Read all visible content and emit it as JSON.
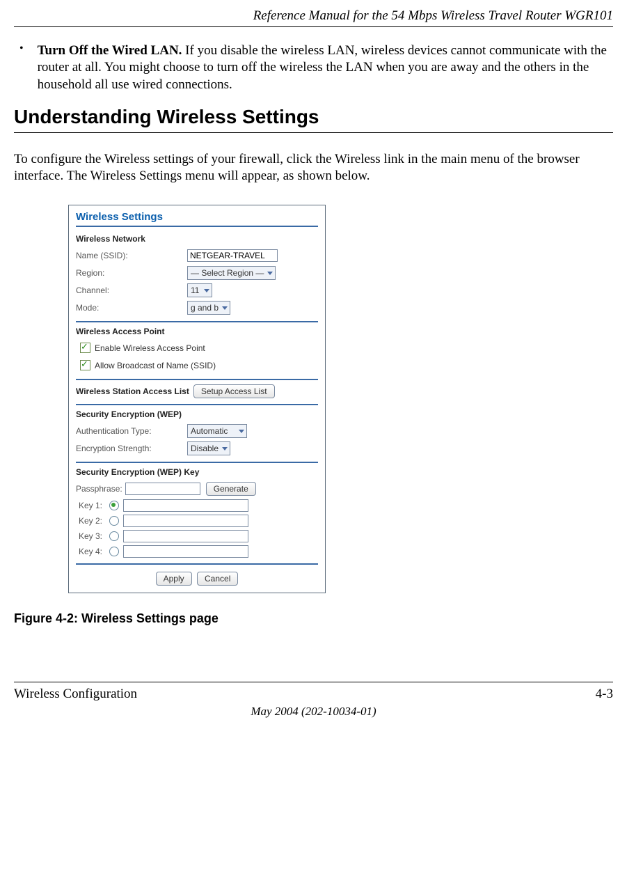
{
  "header": {
    "manual_title": "Reference Manual for the 54 Mbps Wireless Travel Router WGR101"
  },
  "bullet": {
    "title": "Turn Off the Wired LAN.",
    "text": " If you disable the wireless LAN, wireless devices cannot communicate with the router at all. You might choose to turn off the wireless the LAN when you are away and the others in the household all use wired connections."
  },
  "section_heading": "Understanding Wireless Settings",
  "intro_paragraph": "To configure the Wireless settings of your firewall, click the Wireless link in the main menu of the browser interface. The Wireless Settings menu will appear, as shown below.",
  "ui": {
    "title": "Wireless Settings",
    "wireless_network": {
      "heading": "Wireless Network",
      "name_label": "Name (SSID):",
      "name_value": "NETGEAR-TRAVEL",
      "region_label": "Region:",
      "region_value": "— Select Region —",
      "channel_label": "Channel:",
      "channel_value": "11",
      "mode_label": "Mode:",
      "mode_value": "g and b"
    },
    "access_point": {
      "heading": "Wireless Access Point",
      "enable_label": "Enable Wireless Access Point",
      "broadcast_label": "Allow Broadcast of Name (SSID)"
    },
    "station_access": {
      "heading": "Wireless Station Access List",
      "button": "Setup Access List"
    },
    "wep": {
      "heading": "Security Encryption (WEP)",
      "auth_label": "Authentication Type:",
      "auth_value": "Automatic",
      "enc_label": "Encryption Strength:",
      "enc_value": "Disable"
    },
    "wep_key": {
      "heading": "Security Encryption (WEP) Key",
      "passphrase_label": "Passphrase:",
      "generate_button": "Generate",
      "key1": "Key 1:",
      "key2": "Key 2:",
      "key3": "Key 3:",
      "key4": "Key 4:"
    },
    "buttons": {
      "apply": "Apply",
      "cancel": "Cancel"
    }
  },
  "figure_caption": "Figure 4-2:  Wireless Settings page",
  "footer": {
    "section": "Wireless Configuration",
    "page": "4-3",
    "date_line": "May 2004 (202-10034-01)"
  }
}
